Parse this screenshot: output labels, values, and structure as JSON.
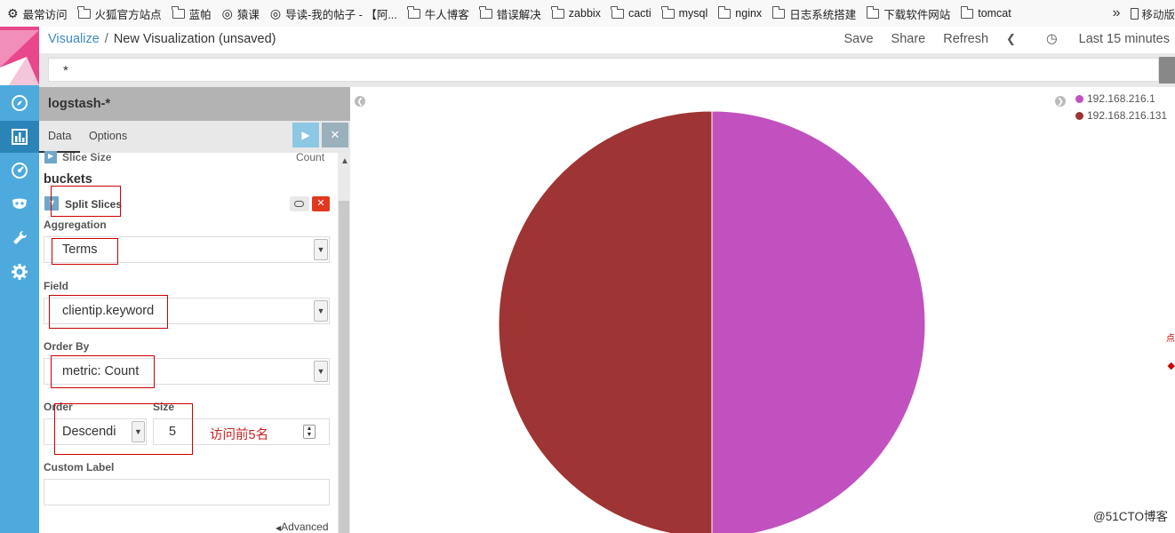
{
  "bookmarks": {
    "items": [
      {
        "icon": "gear-icon",
        "label": "最常访问"
      },
      {
        "icon": "folder-icon",
        "label": "火狐官方站点"
      },
      {
        "icon": "folder-icon",
        "label": "蓝帕"
      },
      {
        "icon": "site-icon",
        "label": "猿课"
      },
      {
        "icon": "site-icon",
        "label": "导读-我的帖子 - 【阿..."
      },
      {
        "icon": "folder-icon",
        "label": "牛人博客"
      },
      {
        "icon": "folder-icon",
        "label": "错误解决"
      },
      {
        "icon": "folder-icon",
        "label": "zabbix"
      },
      {
        "icon": "folder-icon",
        "label": "cacti"
      },
      {
        "icon": "folder-icon",
        "label": "mysql"
      },
      {
        "icon": "folder-icon",
        "label": "nginx"
      },
      {
        "icon": "folder-icon",
        "label": "日志系统搭建"
      },
      {
        "icon": "folder-icon",
        "label": "下载软件网站"
      },
      {
        "icon": "folder-icon",
        "label": "tomcat"
      }
    ],
    "overflow_label": "移动版"
  },
  "header": {
    "breadcrumb_link": "Visualize",
    "breadcrumb_sep": "/",
    "breadcrumb_current": "New Visualization (unsaved)",
    "save": "Save",
    "share": "Share",
    "refresh": "Refresh",
    "time_range": "Last 15 minutes"
  },
  "query": {
    "value": "*"
  },
  "panel": {
    "index_pattern": "logstash-*",
    "tabs": {
      "data": "Data",
      "options": "Options"
    },
    "metric_row": {
      "label": "Slice Size",
      "value": "Count"
    },
    "buckets_heading": "buckets",
    "bucket_title": "Split Slices",
    "aggregation": {
      "label": "Aggregation",
      "value": "Terms"
    },
    "field": {
      "label": "Field",
      "value": "clientip.keyword"
    },
    "order_by": {
      "label": "Order By",
      "value": "metric: Count"
    },
    "order": {
      "label": "Order",
      "value": "Descending",
      "display": "Descendi"
    },
    "size": {
      "label": "Size",
      "value": "5"
    },
    "size_note": "访问前5名",
    "custom_label": {
      "label": "Custom Label",
      "value": ""
    },
    "advanced": "Advanced"
  },
  "colors": {
    "kibana_pink": "#e8478b",
    "kibana_blue": "#4eaadc",
    "annotation_red": "#cc0000"
  },
  "chart_data": {
    "type": "pie",
    "labels": [
      "192.168.216.1",
      "192.168.216.131"
    ],
    "values": [
      50,
      50
    ],
    "colors": [
      "#c151bf",
      "#9e3433"
    ],
    "legend_position": "top-right"
  },
  "watermark": "@51CTO博客",
  "edge_marks": [
    "点"
  ]
}
